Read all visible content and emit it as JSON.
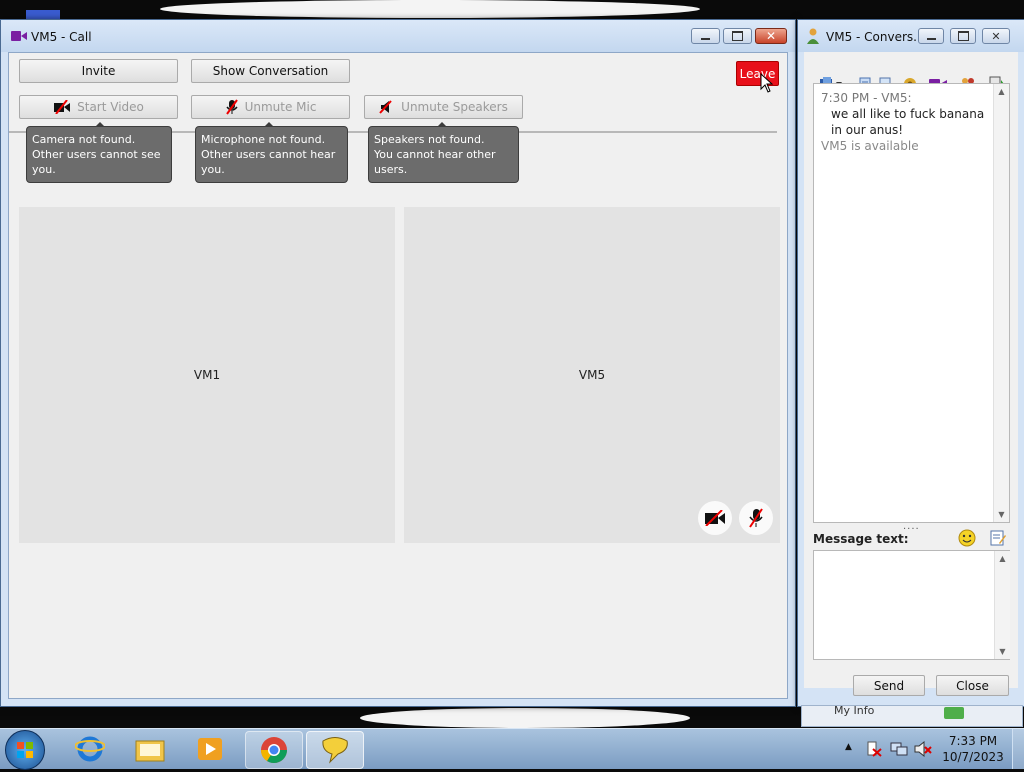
{
  "call_window": {
    "title": "VM5 - Call",
    "buttons": {
      "invite": "Invite",
      "show_conversation": "Show Conversation",
      "leave": "Leave",
      "start_video": "Start Video",
      "unmute_mic": "Unmute Mic",
      "unmute_speakers": "Unmute Speakers"
    },
    "tooltips": {
      "camera": [
        "Camera not found.",
        "Other users cannot see you."
      ],
      "microphone": [
        "Microphone not found.",
        "Other users cannot hear you."
      ],
      "speakers": [
        "Speakers not found.",
        "You cannot hear other users."
      ]
    },
    "participants": [
      "VM1",
      "VM5"
    ]
  },
  "conversation_window": {
    "title": "VM5 - Convers...",
    "messages": [
      {
        "header": "7:30 PM - VM5:",
        "body": "we all like to fuck banana in our anus!"
      }
    ],
    "status": "VM5 is available",
    "message_label": "Message text:",
    "message_value": "",
    "send": "Send",
    "close": "Close",
    "behind_label": "My Info"
  },
  "taskbar": {
    "time": "7:33 PM",
    "date": "10/7/2023"
  },
  "colors": {
    "leave_button": "#e8101a",
    "call_icon": "#7a1fa2",
    "title_gradient_top": "#dbe8f8"
  }
}
